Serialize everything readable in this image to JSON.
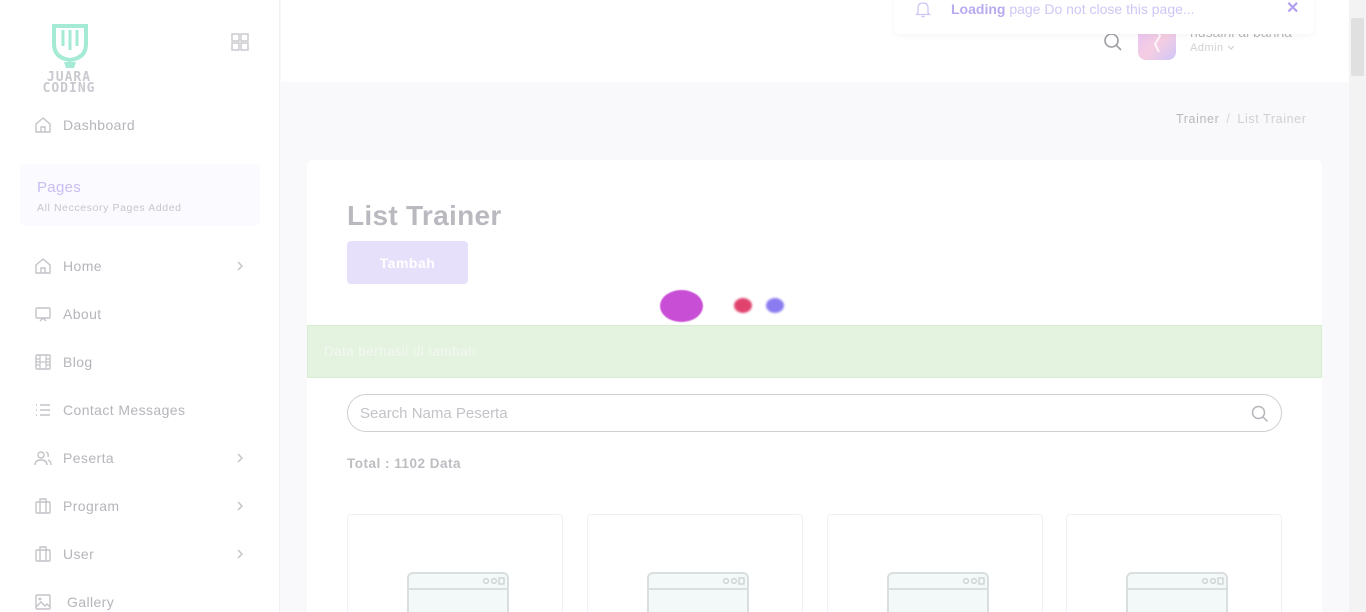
{
  "brand": {
    "logo_line1": "JUARA",
    "logo_line2": "CODING",
    "logo_color": "#9be5cf"
  },
  "sidebar": {
    "dashboard": {
      "label": "Dashboard",
      "icon": "home-icon"
    },
    "pages_title": "Pages",
    "pages_subtitle": "All Neccesory Pages Added",
    "items": [
      {
        "label": "Home",
        "icon": "home-icon",
        "has_submenu": true
      },
      {
        "label": "About",
        "icon": "monitor-icon",
        "has_submenu": false
      },
      {
        "label": "Blog",
        "icon": "film-icon",
        "has_submenu": false
      },
      {
        "label": "Contact Messages",
        "icon": "list-icon",
        "has_submenu": false
      },
      {
        "label": "Peserta",
        "icon": "users-icon",
        "has_submenu": true
      },
      {
        "label": "Program",
        "icon": "briefcase-icon",
        "has_submenu": true
      },
      {
        "label": "User",
        "icon": "briefcase-icon",
        "has_submenu": true
      },
      {
        "label": "Gallery",
        "icon": "image-icon",
        "has_submenu": false
      }
    ]
  },
  "header": {
    "user_name": "husaini al banna",
    "user_role": "Admin"
  },
  "toast": {
    "bold": "Loading",
    "message": " page Do not close this page..."
  },
  "breadcrumb": {
    "parent": "Trainer",
    "separator": "/",
    "current": "List Trainer"
  },
  "main": {
    "title": "List Trainer",
    "add_button": "Tambah",
    "alert": "Data berhasil di tambah",
    "search_placeholder": "Search Nama Peserta",
    "total": "Total : 1102 Data"
  },
  "colors": {
    "accent": "#b9aaf0",
    "loader_magenta": "#c94ed6",
    "loader_red": "#e0446e",
    "loader_blue": "#8a7cf0",
    "alert_bg": "#e4f3e0"
  }
}
